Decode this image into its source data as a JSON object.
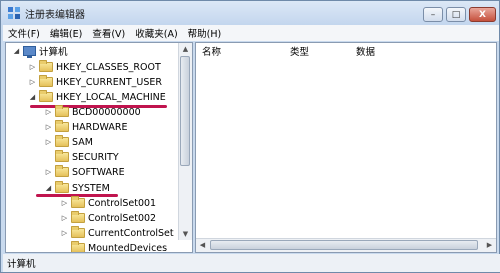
{
  "window": {
    "title": "注册表编辑器",
    "close_label": "X"
  },
  "menu": [
    "文件(F)",
    "编辑(E)",
    "查看(V)",
    "收藏夹(A)",
    "帮助(H)"
  ],
  "tree": {
    "root": "计算机",
    "hkcr": "HKEY_CLASSES_ROOT",
    "hkcu": "HKEY_CURRENT_USER",
    "hklm": "HKEY_LOCAL_MACHINE",
    "bcd": "BCD00000000",
    "hardware": "HARDWARE",
    "sam": "SAM",
    "security": "SECURITY",
    "software": "SOFTWARE",
    "system": "SYSTEM",
    "cs001": "ControlSet001",
    "cs002": "ControlSet002",
    "ccs": "CurrentControlSet",
    "mounted": "MountedDevices"
  },
  "columns": {
    "name": "名称",
    "type": "类型",
    "data": "数据"
  },
  "status": "计算机",
  "icons": [
    "regedit-icon",
    "computer-icon",
    "folder-icon",
    "expand-arrow-icon",
    "collapse-arrow-icon",
    "minimize-icon",
    "maximize-icon",
    "close-icon"
  ],
  "colors": {
    "highlight_underline": "#c0144e",
    "titlebar": "#c3d6ee"
  }
}
